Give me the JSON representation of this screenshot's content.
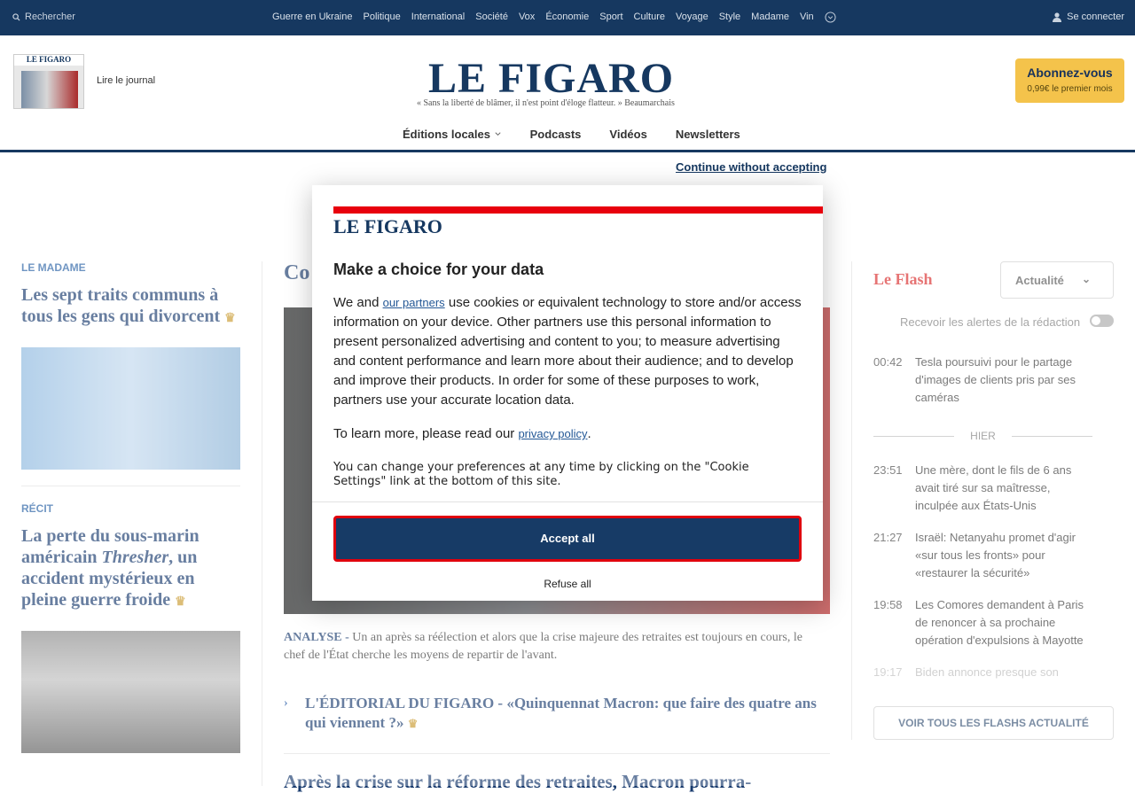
{
  "topbar": {
    "search_label": "Rechercher",
    "nav_items": [
      "Guerre en Ukraine",
      "Politique",
      "International",
      "Société",
      "Vox",
      "Économie",
      "Sport",
      "Culture",
      "Voyage",
      "Style",
      "Madame",
      "Vin"
    ],
    "login_label": "Se connecter"
  },
  "header": {
    "read_label": "Lire le journal",
    "logo": "LE FIGARO",
    "journal_mast": "LE FIGARO",
    "motto": "« Sans la liberté de blâmer, il n'est point d'éloge flatteur. » Beaumarchais",
    "subscribe_title": "Abonnez-vous",
    "subscribe_sub": "0,99€ le premier mois",
    "secnav": [
      "Éditions locales",
      "Podcasts",
      "Vidéos",
      "Newsletters"
    ]
  },
  "left": {
    "tag1": "LE MADAME",
    "title1": "Les sept traits communs à tous les gens qui divorcent",
    "tag2": "RÉCIT",
    "title2a": "La perte du sous-marin américain ",
    "title2b": "Thresher",
    "title2c": ", un accident mystérieux en pleine guerre froide"
  },
  "center": {
    "title_partial": "Co",
    "caption_label": "ANALYSE -",
    "caption_text": "Un an après sa réélection et alors que la crise majeure des retraites est toujours en cours, le chef de l'État cherche les moyens de repartir de l'avant.",
    "related": "L'ÉDITORIAL DU FIGARO - «Quinquennat Macron: que faire des quatre ans qui viennent ?»",
    "next": "Après la crise sur la réforme des retraites, Macron pourra-"
  },
  "flash": {
    "title": "Le Flash",
    "dropdown": "Actualité",
    "alert": "Recevoir les alertes de la rédaction",
    "items": [
      {
        "time": "00:42",
        "text": "Tesla poursuivi pour le partage d'images de clients pris par ses caméras"
      },
      {
        "time": "23:51",
        "text": "Une mère, dont le fils de 6 ans avait tiré sur sa maîtresse, inculpée aux États-Unis"
      },
      {
        "time": "21:27",
        "text": "Israël: Netanyahu promet d'agir «sur tous les fronts» pour «restaurer la sécurité»"
      },
      {
        "time": "19:58",
        "text": "Les Comores demandent à Paris de renoncer à sa prochaine opération d'expulsions à Mayotte"
      },
      {
        "time": "19:17",
        "text": "Biden annonce presque son"
      }
    ],
    "hier": "HIER",
    "button": "VOIR TOUS LES FLASHS ACTUALITÉ"
  },
  "consent": {
    "continue": "Continue without accepting",
    "logo": "LE FIGARO",
    "title": "Make a choice for your data",
    "p1_before": "We and ",
    "p1_link": "our partners",
    "p1_after": " use cookies or equivalent technology to store and/or access information on your device. Other partners use this personal information to present personalized advertising and content to you; to measure advertising and content performance and learn more about their audience; and to develop and improve their products. In order for some of these purposes to work, partners use your accurate location data.",
    "p2_before": "To learn more, please read our ",
    "p2_link": "privacy policy",
    "p2_after": ".",
    "p3": "You can change your preferences at any time by clicking on the \"Cookie Settings\" link at the bottom of this site.",
    "accept": "Accept all",
    "refuse": "Refuse all"
  },
  "colors": {
    "navy": "#163860",
    "accent_red": "#e8000d",
    "flash_red": "#d92a2a",
    "subscribe": "#f4c34b"
  },
  "icons": [
    "search-icon",
    "chevron-down-icon",
    "user-icon",
    "arrow-right-icon",
    "crown-icon"
  ]
}
